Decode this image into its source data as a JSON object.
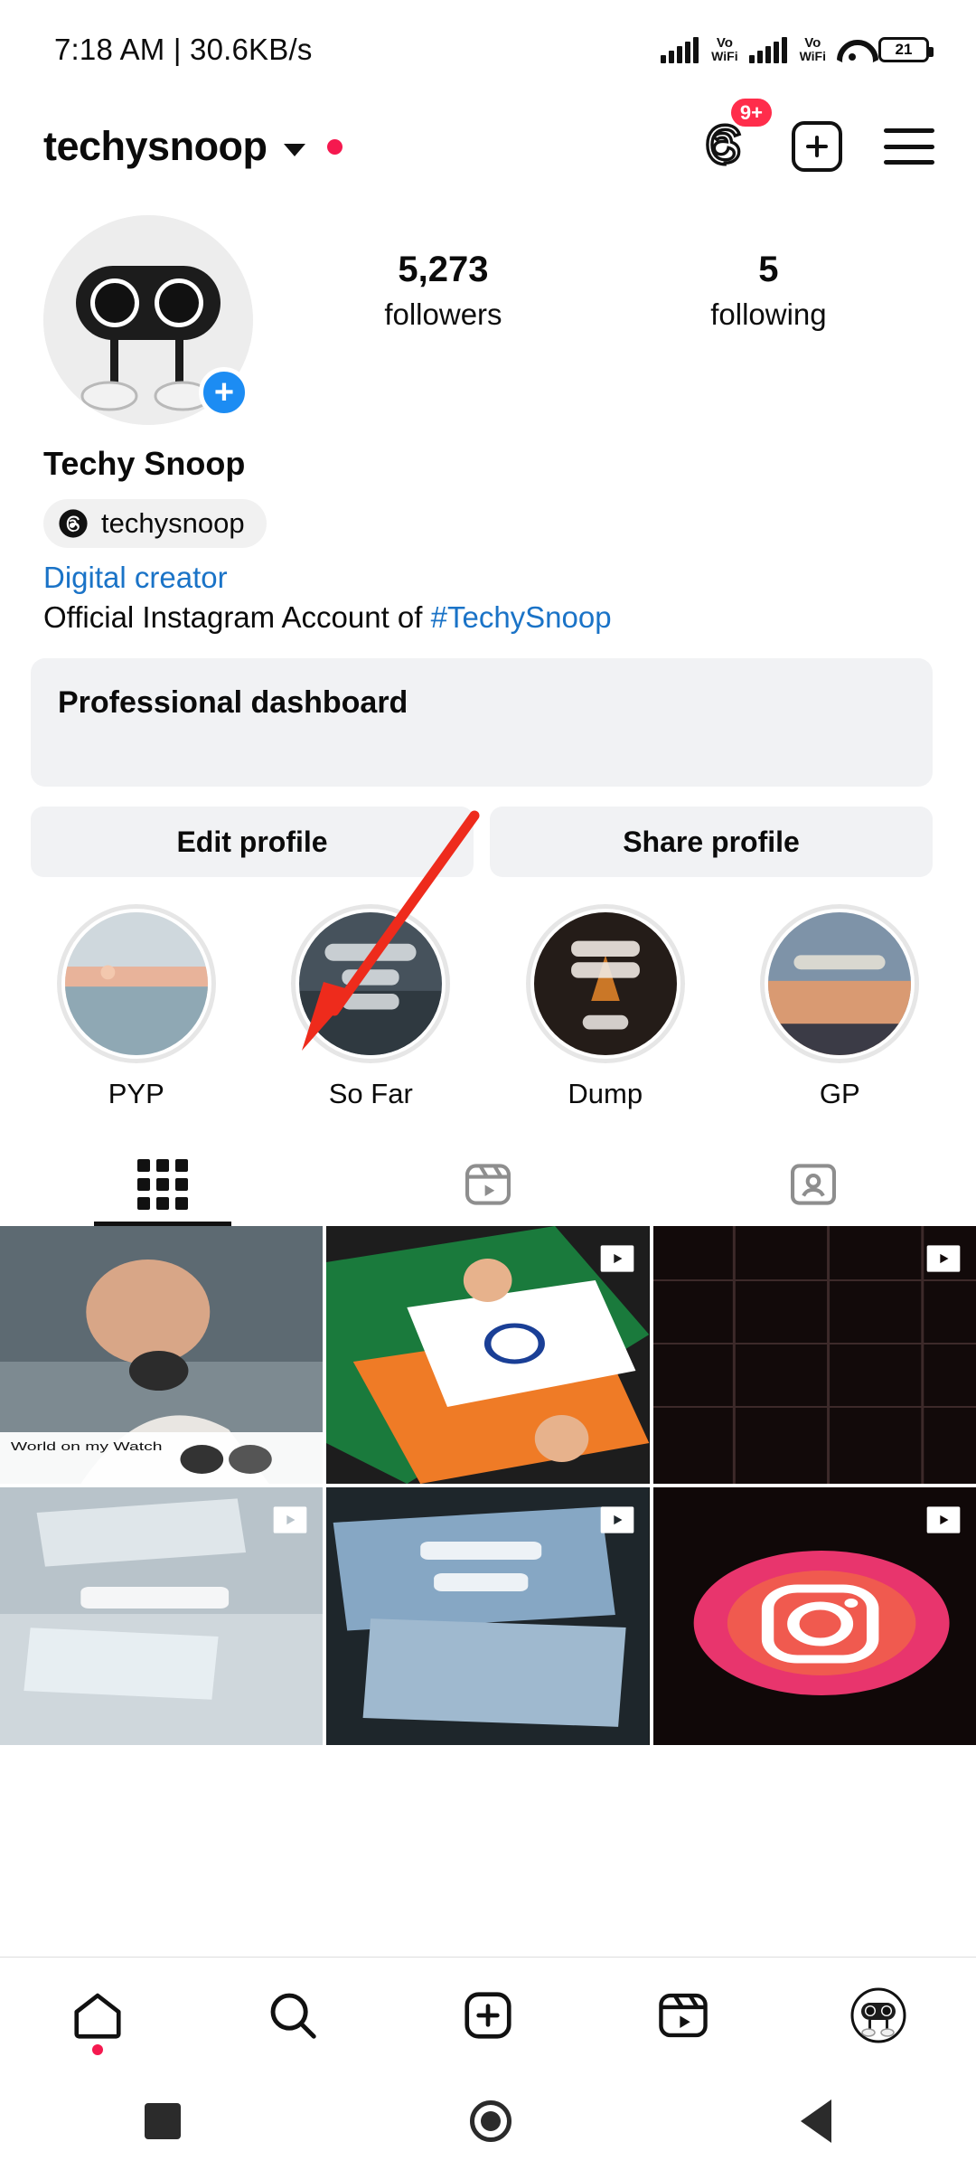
{
  "status_bar": {
    "time": "7:18 AM",
    "separator": "|",
    "network_speed": "30.6KB/s",
    "volte_label": "Vo",
    "volte_sub": "WiFi",
    "battery_level": "21"
  },
  "top_nav": {
    "username": "techysnoop",
    "chevron_icon": "chevron-down-icon",
    "status_dot_color": "#f5194f",
    "threads_icon": "threads-icon",
    "threads_badge": "9+",
    "create_icon": "plus-square-icon",
    "menu_icon": "hamburger-menu-icon"
  },
  "profile": {
    "avatar_add_label": "+",
    "stats": [
      {
        "number": "5,273",
        "label": "followers"
      },
      {
        "number": "5",
        "label": "following"
      }
    ],
    "full_name": "Techy Snoop",
    "threads_handle": "techysnoop",
    "category": "Digital creator",
    "bio_prefix": "Official Instagram Account of ",
    "bio_hashtag": "#TechySnoop"
  },
  "dashboard": {
    "label": "Professional dashboard"
  },
  "actions": [
    {
      "label": "Edit profile"
    },
    {
      "label": "Share profile"
    }
  ],
  "highlights": [
    {
      "name": "PYP",
      "caption": ""
    },
    {
      "name": "So Far",
      "caption": "AUGUST SO FAR"
    },
    {
      "name": "Dump",
      "caption": "JULY DUMP"
    },
    {
      "name": "GP",
      "caption": "GOLDEN"
    }
  ],
  "tabs": [
    {
      "name": "grid-tab",
      "icon": "grid-icon",
      "active": true
    },
    {
      "name": "reels-tab",
      "icon": "reels-icon",
      "active": false
    },
    {
      "name": "tagged-tab",
      "icon": "tagged-person-icon",
      "active": false
    }
  ],
  "media": [
    {
      "type": "photo",
      "caption": "World on my Watch",
      "is_reel": false
    },
    {
      "type": "reel",
      "caption": "",
      "is_reel": true
    },
    {
      "type": "reel",
      "caption": "",
      "is_reel": true
    },
    {
      "type": "reel",
      "caption": "",
      "is_reel": true
    },
    {
      "type": "reel",
      "caption": "SO FAR",
      "is_reel": true
    },
    {
      "type": "reel",
      "caption": "",
      "is_reel": true
    }
  ],
  "bottom_nav": [
    {
      "name": "home-tab",
      "icon": "home-icon",
      "has_dot": true
    },
    {
      "name": "search-tab",
      "icon": "search-icon",
      "has_dot": false
    },
    {
      "name": "create-tab",
      "icon": "plus-square-icon",
      "has_dot": false
    },
    {
      "name": "reels-tab",
      "icon": "reels-icon",
      "has_dot": false
    },
    {
      "name": "profile-tab",
      "icon": "profile-avatar-icon",
      "has_dot": false
    }
  ],
  "system_bar": [
    {
      "name": "recents-button",
      "icon": "square-icon"
    },
    {
      "name": "home-button",
      "icon": "circle-icon"
    },
    {
      "name": "back-button",
      "icon": "back-triangle-icon"
    }
  ],
  "annotation": {
    "arrow_color": "#ee2b1c"
  }
}
